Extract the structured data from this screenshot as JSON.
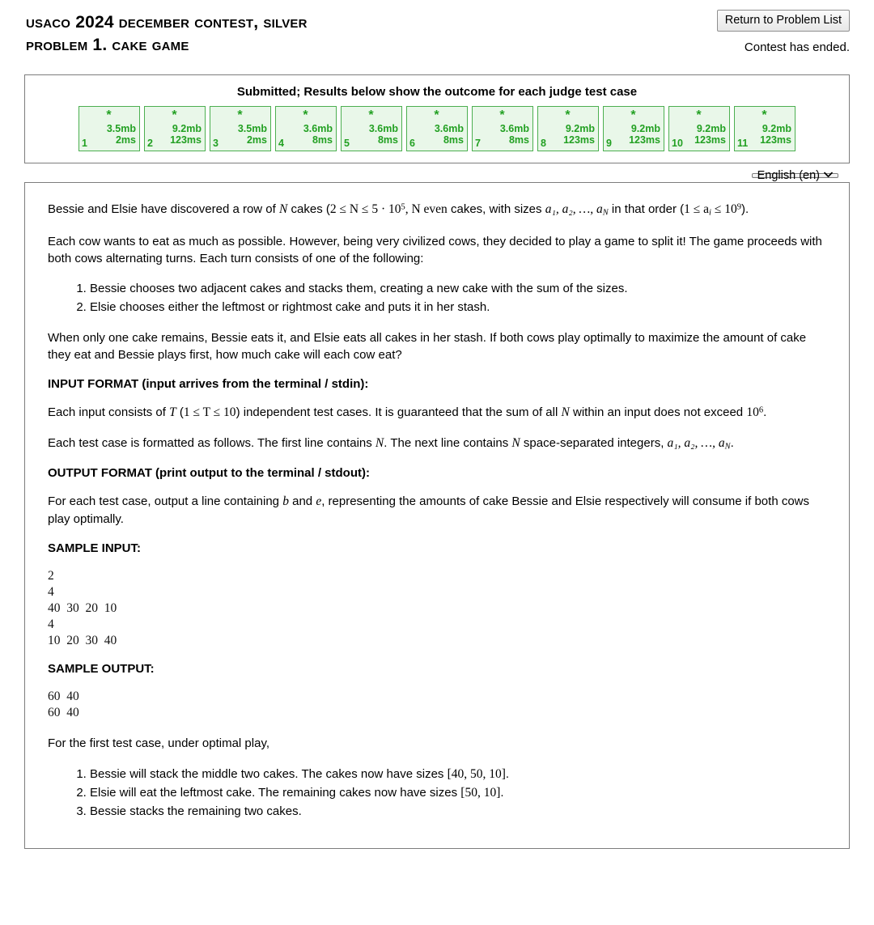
{
  "header": {
    "title_line1": "USACO 2024 December Contest, Silver",
    "title_line2": "Problem 1. Cake Game",
    "return_button": "Return to Problem List",
    "contest_status": "Contest has ended."
  },
  "results": {
    "heading": "Submitted; Results below show the outcome for each judge test case",
    "status_glyph": "*",
    "cases": [
      {
        "index": "1",
        "memory": "3.5mb",
        "time": "2ms",
        "status": "pass"
      },
      {
        "index": "2",
        "memory": "9.2mb",
        "time": "123ms",
        "status": "pass"
      },
      {
        "index": "3",
        "memory": "3.5mb",
        "time": "2ms",
        "status": "pass"
      },
      {
        "index": "4",
        "memory": "3.6mb",
        "time": "8ms",
        "status": "pass"
      },
      {
        "index": "5",
        "memory": "3.6mb",
        "time": "8ms",
        "status": "pass"
      },
      {
        "index": "6",
        "memory": "3.6mb",
        "time": "8ms",
        "status": "pass"
      },
      {
        "index": "7",
        "memory": "3.6mb",
        "time": "8ms",
        "status": "pass"
      },
      {
        "index": "8",
        "memory": "9.2mb",
        "time": "123ms",
        "status": "pass"
      },
      {
        "index": "9",
        "memory": "9.2mb",
        "time": "123ms",
        "status": "pass"
      },
      {
        "index": "10",
        "memory": "9.2mb",
        "time": "123ms",
        "status": "pass"
      },
      {
        "index": "11",
        "memory": "9.2mb",
        "time": "123ms",
        "status": "pass"
      }
    ]
  },
  "language_select": {
    "selected": "English (en)",
    "chevron": "⌄"
  },
  "problem": {
    "intro_p1_a": "Bessie and Elsie have discovered a row of ",
    "intro_p1_b": " cakes (",
    "intro_p1_c": " cakes, with sizes ",
    "intro_p1_d": " in that order (",
    "intro_p1_e": ").",
    "paragraph2": "Each cow wants to eat as much as possible. However, being very civilized cows, they decided to play a game to split it! The game proceeds with both cows alternating turns. Each turn consists of one of the following:",
    "rules": [
      "Bessie chooses two adjacent cakes and stacks them, creating a new cake with the sum of the sizes.",
      "Elsie chooses either the leftmost or rightmost cake and puts it in her stash."
    ],
    "paragraph3": "When only one cake remains, Bessie eats it, and Elsie eats all cakes in her stash. If both cows play optimally to maximize the amount of cake they eat and Bessie plays first, how much cake will each cow eat?",
    "input_format_heading": "INPUT FORMAT (input arrives from the terminal / stdin):",
    "input_p1_a": "Each input consists of ",
    "input_p1_b": " independent test cases. It is guaranteed that the sum of all ",
    "input_p1_c": " within an input does not exceed ",
    "input_p1_d": ".",
    "input_p2_a": "Each test case is formatted as follows. The first line contains ",
    "input_p2_b": ". The next line contains ",
    "input_p2_c": " space-separated integers, ",
    "input_p2_d": ".",
    "output_format_heading": "OUTPUT FORMAT (print output to the terminal / stdout):",
    "output_p1_a": "For each test case, output a line containing ",
    "output_p1_b": " and ",
    "output_p1_c": ", representing the amounts of cake Bessie and Elsie respectively will consume if both cows play optimally.",
    "sample_input_heading": "SAMPLE INPUT:",
    "sample_input": "2\n4\n40  30  20  10\n4\n10  20  30  40",
    "sample_output_heading": "SAMPLE OUTPUT:",
    "sample_output": "60  40\n60  40",
    "explanation_intro": "For the first test case, under optimal play,",
    "explanation_steps": [
      {
        "prefix": "Bessie will stack the middle two cakes. The cakes now have sizes ",
        "math": "[40, 50, 10]",
        "suffix": "."
      },
      {
        "prefix": "Elsie will eat the leftmost cake. The remaining cakes now have sizes ",
        "math": "[50, 10]",
        "suffix": "."
      },
      {
        "prefix": "Bessie stacks the remaining two cakes.",
        "math": "",
        "suffix": ""
      }
    ],
    "math": {
      "N": "N",
      "N_range": "2 ≤ N ≤ 5 · 10",
      "N_range_exp": "5",
      "N_even": ", N even",
      "sizes": "a₁, a₂, …, a",
      "sizes_sub": "N",
      "a_bound_pre": "1 ≤ a",
      "a_bound_sub": "i",
      "a_bound_mid": " ≤ 10",
      "a_bound_exp": "9",
      "T_range": "1 ≤ T ≤ 10",
      "T": "T",
      "sum_limit": "10",
      "sum_limit_exp": "6",
      "b": "b",
      "e": "e"
    }
  },
  "colors": {
    "pass_green": "#22a022",
    "pass_bg": "#e9f7e9",
    "pass_border": "#4caf50",
    "panel_border": "#7d7d7d"
  }
}
